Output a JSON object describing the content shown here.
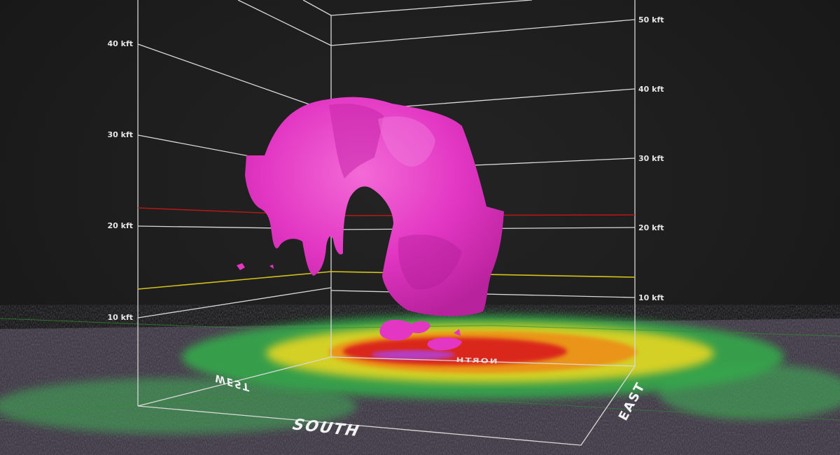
{
  "scene": {
    "left_axis_ticks": [
      "10 kft",
      "20 kft",
      "30 kft",
      "40 kft"
    ],
    "right_axis_ticks": [
      "10 kft",
      "20 kft",
      "30 kft",
      "40 kft",
      "50 kft"
    ],
    "directions": {
      "south": "SOUTH",
      "west": "WEST",
      "east": "EAST",
      "north": "NORTH"
    },
    "colors": {
      "background": "#1b1b1b",
      "isosurface": "#e236c3",
      "grid_lines": "#d8d8d8",
      "freezing_level": "#b01818",
      "reference_level": "#d4c21a",
      "reflectivity_low": "#7c6b8e",
      "reflectivity_green": "#2fa34a",
      "reflectivity_yellow": "#e5d620",
      "reflectivity_red": "#d9231c"
    }
  }
}
